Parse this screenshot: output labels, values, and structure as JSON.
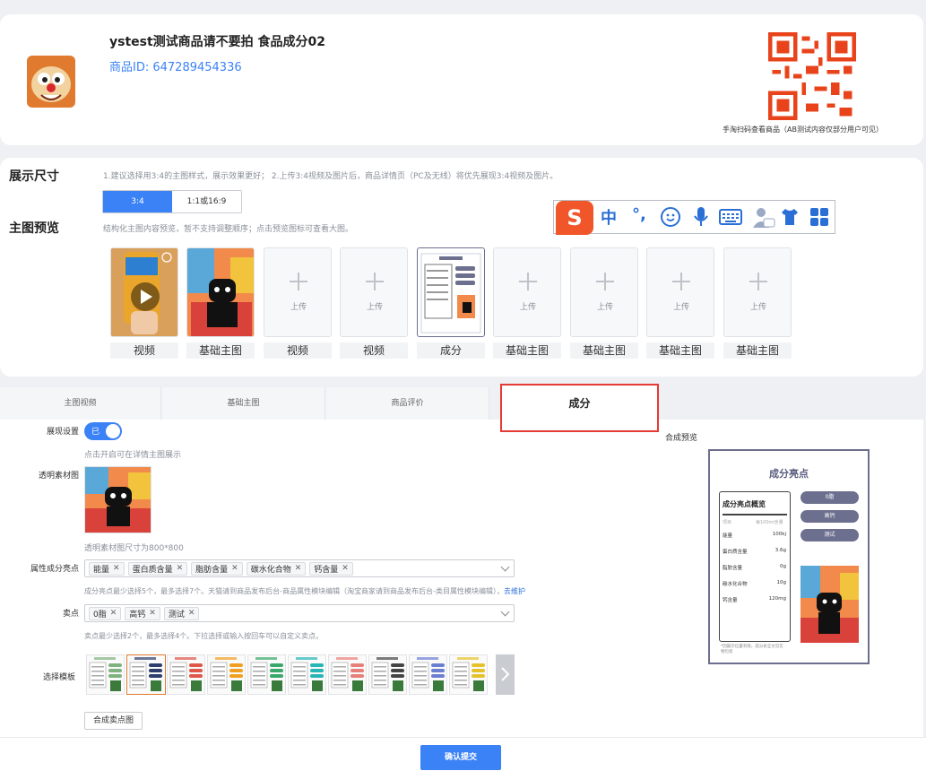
{
  "product": {
    "title": "ystest测试商品请不要拍 食品成分02",
    "id_label": "商品ID: 647289454336",
    "qr_note": "手淘扫码查看商品（AB测试内容仅部分用户可见）"
  },
  "display": {
    "size_label": "展示尺寸",
    "size_hint": "1.建议选择用3:4的主图样式，展示效果更好； 2.上传3:4视频及图片后，商品详情页（PC及无线）将优先展现3:4视频及图片。",
    "ratio_options": [
      "3:4",
      "1:1或16:9"
    ],
    "preview_label": "主图预览",
    "preview_hint": "结构化主图内容预览，暂不支持调整顺序；点击预览图标可查看大图。",
    "upload_text": "上传",
    "thumbs": [
      "视频",
      "基础主图",
      "视频",
      "视频",
      "成分",
      "基础主图",
      "基础主图",
      "基础主图",
      "基础主图"
    ]
  },
  "ime": {
    "logo": "S",
    "lang": "中",
    "punct": "°,"
  },
  "tabs": [
    "主图视频",
    "基础主图",
    "商品评价",
    "成分"
  ],
  "form": {
    "toggle_label": "展现设置",
    "toggle_text": "已",
    "toggle_hint": "点击开启可在详情主图展示",
    "material_label": "透明素材图",
    "material_hint": "透明素材图尺寸为800*800",
    "attr_label": "属性成分亮点",
    "attr_tags": [
      "能量",
      "蛋白质含量",
      "脂肪含量",
      "碳水化合物",
      "钙含量"
    ],
    "attr_hint": "成分亮点最少选择5个，最多选择7个。天猫请到商品发布后台-商品属性模块编辑（淘宝商家请到商品发布后台-类目属性模块编辑），",
    "attr_link": "去维护",
    "sell_label": "卖点",
    "sell_tags": [
      "0脂",
      "高钙",
      "测试"
    ],
    "sell_hint": "卖点最少选择2个，最多选择4个。下拉选择或输入按回车可以自定义卖点。",
    "template_label": "选择模板",
    "compose_button": "合成卖点图",
    "submit_button": "确认提交"
  },
  "preview": {
    "label": "合成预览",
    "title": "成分亮点",
    "panel_title": "成分亮点概览",
    "panel_header": [
      "项目",
      "每100ml含量"
    ],
    "rows": [
      {
        "name": "能量",
        "value": "100kj"
      },
      {
        "name": "蛋白质含量",
        "value": "3.6g"
      },
      {
        "name": "脂肪含量",
        "value": "0g"
      },
      {
        "name": "碳水化合物",
        "value": "10g"
      },
      {
        "name": "钙含量",
        "value": "120mg"
      }
    ],
    "pills": [
      "0脂",
      "高钙",
      "测试"
    ],
    "footnote": "*因篇示位置有限，成分表全文见实物包装"
  },
  "colors": {
    "accent": "#3b82f6",
    "highlight_border": "#e53935",
    "preview_border": "#6c6e8e",
    "pill": "#6d6f8f",
    "qr": "#e8431a"
  }
}
